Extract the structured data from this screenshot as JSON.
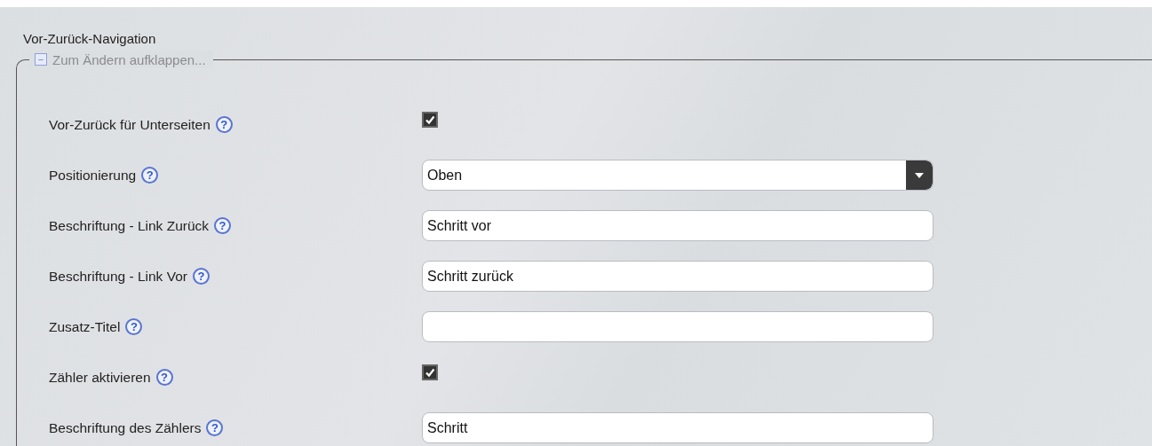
{
  "section_title": "Vor-Zurück-Navigation",
  "fieldset": {
    "toggle_symbol": "−",
    "legend": "Zum Ändern aufklappen...",
    "expanded": true
  },
  "rows": [
    {
      "label": "Vor-Zurück für Unterseiten",
      "help": "?",
      "kind": "checkbox",
      "checked": true
    },
    {
      "label": "Positionierung",
      "help": "?",
      "kind": "select",
      "value": "Oben"
    },
    {
      "label": "Beschriftung - Link Zurück",
      "help": "?",
      "kind": "text",
      "value": "Schritt vor"
    },
    {
      "label": "Beschriftung - Link Vor",
      "help": "?",
      "kind": "text",
      "value": "Schritt zurück"
    },
    {
      "label": "Zusatz-Titel",
      "help": "?",
      "kind": "text"
    },
    {
      "label": "Zähler aktivieren",
      "help": "?",
      "kind": "checkbox",
      "checked": true
    },
    {
      "label": "Beschriftung des Zählers",
      "help": "?",
      "kind": "text",
      "value": "Schritt"
    }
  ]
}
